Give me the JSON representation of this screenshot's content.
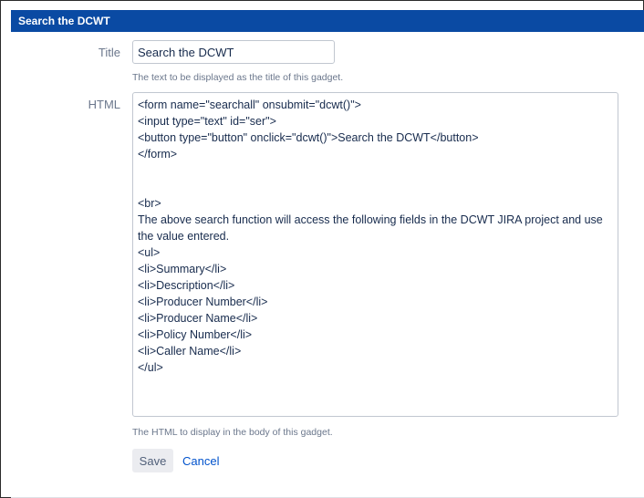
{
  "dialog": {
    "header_title": "Search the DCWT"
  },
  "form": {
    "title_label": "Title",
    "title_value": "Search the DCWT",
    "title_help": "The text to be displayed as the title of this gadget.",
    "html_label": "HTML",
    "html_value": "<form name=\"searchall\" onsubmit=\"dcwt()\">\n<input type=\"text\" id=\"ser\">\n<button type=\"button\" onclick=\"dcwt()\">Search the DCWT</button>\n</form>\n\n\n<br>\nThe above search function will access the following fields in the DCWT JIRA project and use the value entered.\n<ul>\n<li>Summary</li>\n<li>Description</li>\n<li>Producer Number</li>\n<li>Producer Name</li>\n<li>Policy Number</li>\n<li>Caller Name</li>\n</ul>",
    "html_help": "The HTML to display in the body of this gadget."
  },
  "actions": {
    "save_label": "Save",
    "cancel_label": "Cancel"
  }
}
